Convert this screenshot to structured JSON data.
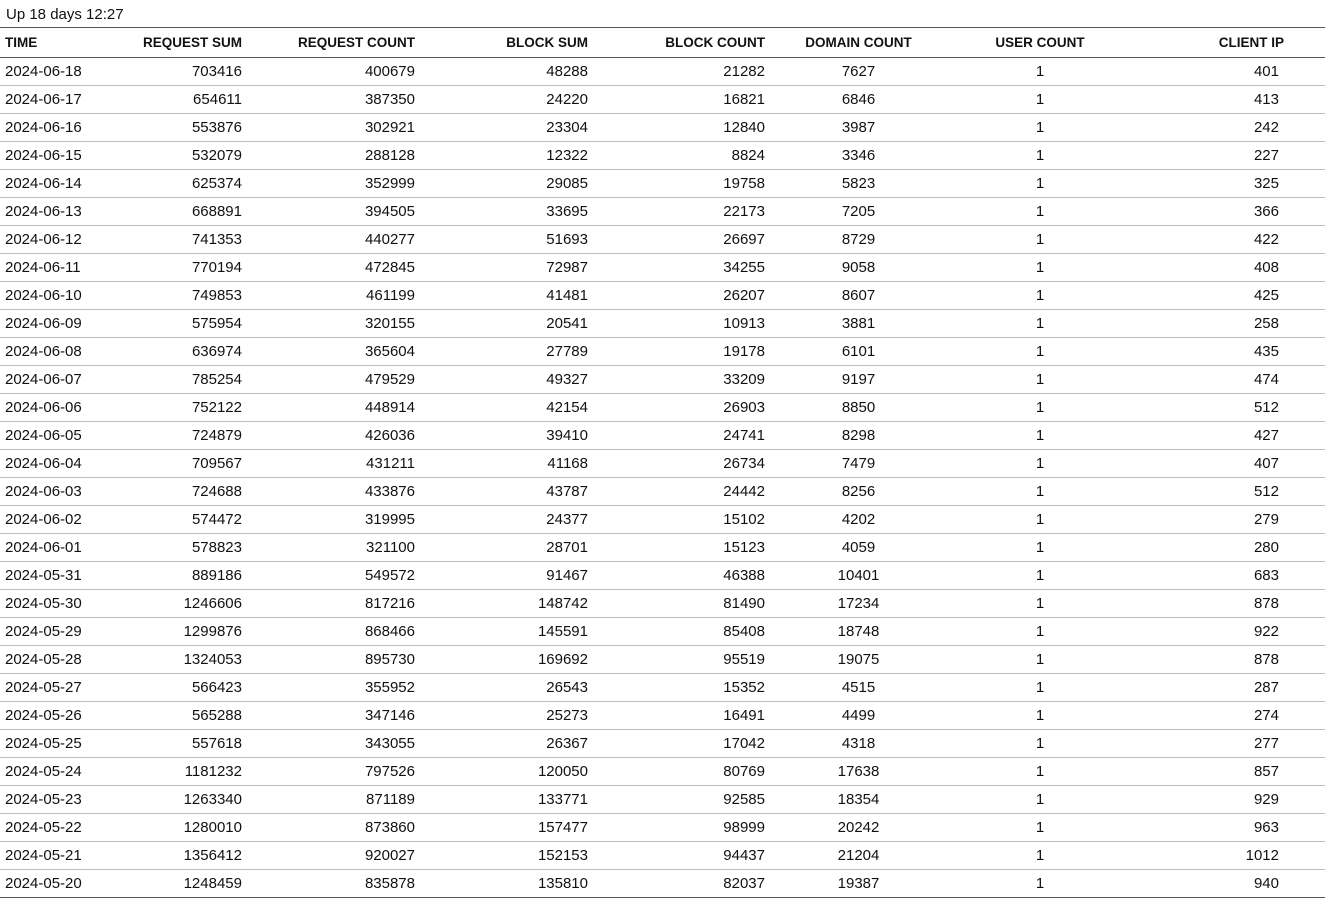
{
  "status": "Up 18 days 12:27",
  "columns": [
    "TIME",
    "REQUEST SUM",
    "REQUEST COUNT",
    "BLOCK SUM",
    "BLOCK COUNT",
    "DOMAIN COUNT",
    "USER COUNT",
    "CLIENT IP"
  ],
  "rows": [
    [
      "2024-06-18",
      "703416",
      "400679",
      "48288",
      "21282",
      "7627",
      "1",
      "401"
    ],
    [
      "2024-06-17",
      "654611",
      "387350",
      "24220",
      "16821",
      "6846",
      "1",
      "413"
    ],
    [
      "2024-06-16",
      "553876",
      "302921",
      "23304",
      "12840",
      "3987",
      "1",
      "242"
    ],
    [
      "2024-06-15",
      "532079",
      "288128",
      "12322",
      "8824",
      "3346",
      "1",
      "227"
    ],
    [
      "2024-06-14",
      "625374",
      "352999",
      "29085",
      "19758",
      "5823",
      "1",
      "325"
    ],
    [
      "2024-06-13",
      "668891",
      "394505",
      "33695",
      "22173",
      "7205",
      "1",
      "366"
    ],
    [
      "2024-06-12",
      "741353",
      "440277",
      "51693",
      "26697",
      "8729",
      "1",
      "422"
    ],
    [
      "2024-06-11",
      "770194",
      "472845",
      "72987",
      "34255",
      "9058",
      "1",
      "408"
    ],
    [
      "2024-06-10",
      "749853",
      "461199",
      "41481",
      "26207",
      "8607",
      "1",
      "425"
    ],
    [
      "2024-06-09",
      "575954",
      "320155",
      "20541",
      "10913",
      "3881",
      "1",
      "258"
    ],
    [
      "2024-06-08",
      "636974",
      "365604",
      "27789",
      "19178",
      "6101",
      "1",
      "435"
    ],
    [
      "2024-06-07",
      "785254",
      "479529",
      "49327",
      "33209",
      "9197",
      "1",
      "474"
    ],
    [
      "2024-06-06",
      "752122",
      "448914",
      "42154",
      "26903",
      "8850",
      "1",
      "512"
    ],
    [
      "2024-06-05",
      "724879",
      "426036",
      "39410",
      "24741",
      "8298",
      "1",
      "427"
    ],
    [
      "2024-06-04",
      "709567",
      "431211",
      "41168",
      "26734",
      "7479",
      "1",
      "407"
    ],
    [
      "2024-06-03",
      "724688",
      "433876",
      "43787",
      "24442",
      "8256",
      "1",
      "512"
    ],
    [
      "2024-06-02",
      "574472",
      "319995",
      "24377",
      "15102",
      "4202",
      "1",
      "279"
    ],
    [
      "2024-06-01",
      "578823",
      "321100",
      "28701",
      "15123",
      "4059",
      "1",
      "280"
    ],
    [
      "2024-05-31",
      "889186",
      "549572",
      "91467",
      "46388",
      "10401",
      "1",
      "683"
    ],
    [
      "2024-05-30",
      "1246606",
      "817216",
      "148742",
      "81490",
      "17234",
      "1",
      "878"
    ],
    [
      "2024-05-29",
      "1299876",
      "868466",
      "145591",
      "85408",
      "18748",
      "1",
      "922"
    ],
    [
      "2024-05-28",
      "1324053",
      "895730",
      "169692",
      "95519",
      "19075",
      "1",
      "878"
    ],
    [
      "2024-05-27",
      "566423",
      "355952",
      "26543",
      "15352",
      "4515",
      "1",
      "287"
    ],
    [
      "2024-05-26",
      "565288",
      "347146",
      "25273",
      "16491",
      "4499",
      "1",
      "274"
    ],
    [
      "2024-05-25",
      "557618",
      "343055",
      "26367",
      "17042",
      "4318",
      "1",
      "277"
    ],
    [
      "2024-05-24",
      "1181232",
      "797526",
      "120050",
      "80769",
      "17638",
      "1",
      "857"
    ],
    [
      "2024-05-23",
      "1263340",
      "871189",
      "133771",
      "92585",
      "18354",
      "1",
      "929"
    ],
    [
      "2024-05-22",
      "1280010",
      "873860",
      "157477",
      "98999",
      "20242",
      "1",
      "963"
    ],
    [
      "2024-05-21",
      "1356412",
      "920027",
      "152153",
      "94437",
      "21204",
      "1",
      "1012"
    ],
    [
      "2024-05-20",
      "1248459",
      "835878",
      "135810",
      "82037",
      "19387",
      "1",
      "940"
    ]
  ]
}
